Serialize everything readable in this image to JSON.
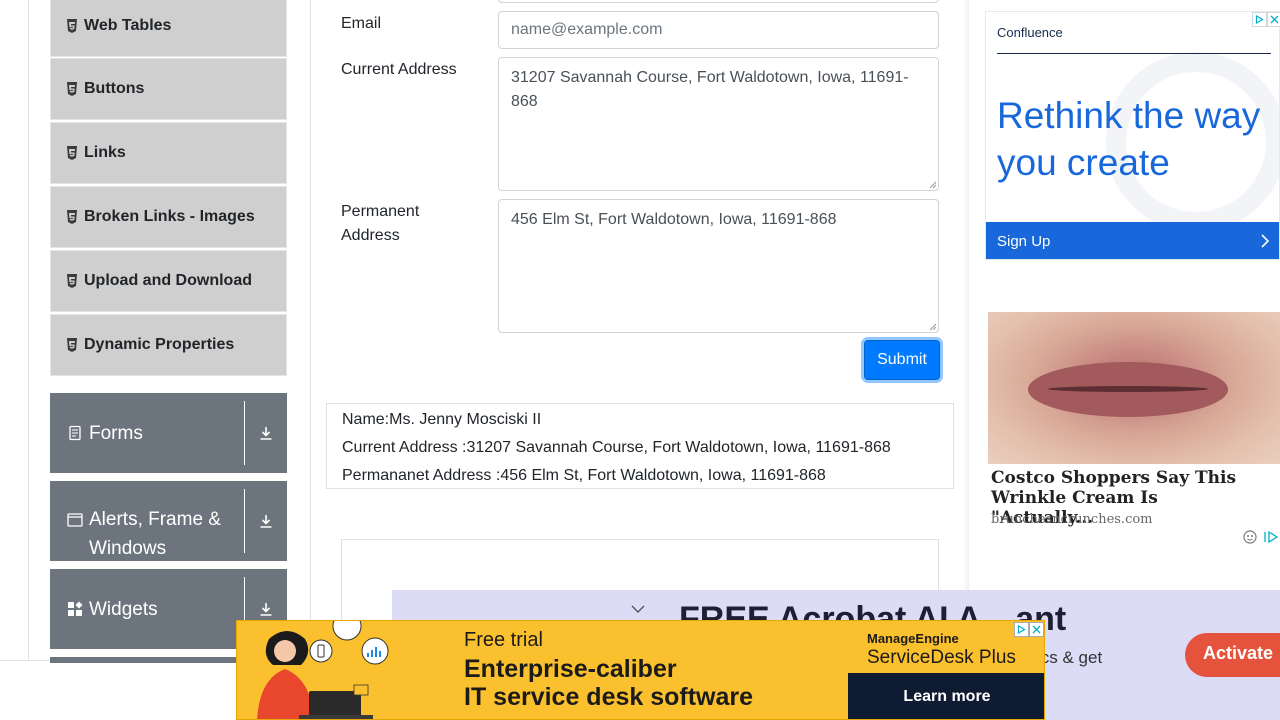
{
  "sidebar": {
    "items": [
      {
        "label": "Web Tables"
      },
      {
        "label": "Buttons"
      },
      {
        "label": "Links"
      },
      {
        "label": "Broken Links - Images"
      },
      {
        "label": "Upload and Download"
      },
      {
        "label": "Dynamic Properties"
      }
    ],
    "groups": [
      {
        "label": "Forms",
        "icon": "document-icon"
      },
      {
        "label": "Alerts, Frame & Windows",
        "icon": "window-icon"
      },
      {
        "label": "Widgets",
        "icon": "widgets-icon"
      }
    ]
  },
  "form": {
    "email_label": "Email",
    "email_placeholder": "name@example.com",
    "current_address_label": "Current Address",
    "current_address_value": "31207 Savannah Course, Fort Waldotown, Iowa, 11691-868",
    "permanent_address_label": "Permanent Address",
    "permanent_address_value": "456 Elm St, Fort Waldotown, Iowa, 11691-868",
    "submit_label": "Submit"
  },
  "output": {
    "name": "Name:Ms. Jenny Mosciski II",
    "current_address": "Current Address :31207 Savannah Course, Fort Waldotown, Iowa, 11691-868",
    "permanent_address": "Permananet Address :456 Elm St, Fort Waldotown, Iowa, 11691-868"
  },
  "right_ad": {
    "brand": "Confluence",
    "headline": "Rethink the way you create",
    "cta": "Sign Up",
    "article_title": "Costco Shoppers Say This Wrinkle Cream Is \"Actually...",
    "article_source": "brunchesncrunches.com"
  },
  "bottom_ad_lavender": {
    "headline": "FREE Acrobat AI A…ant",
    "sub": "ur docs & get",
    "cta": "Activate"
  },
  "bottom_ad_yellow": {
    "tagline": "Free trial",
    "headline_line1": "Enterprise-caliber",
    "headline_line2": "IT service desk software",
    "brand_top": "ManageEngine",
    "brand_bottom": "ServiceDesk Plus",
    "cta": "Learn more"
  },
  "colors": {
    "sidebar_item_bg": "#cfcfcf",
    "group_header_bg": "#6c757d",
    "submit_bg": "#007bff",
    "confluence_blue": "#1868db",
    "yellow_ad_bg": "#fbc02d"
  }
}
